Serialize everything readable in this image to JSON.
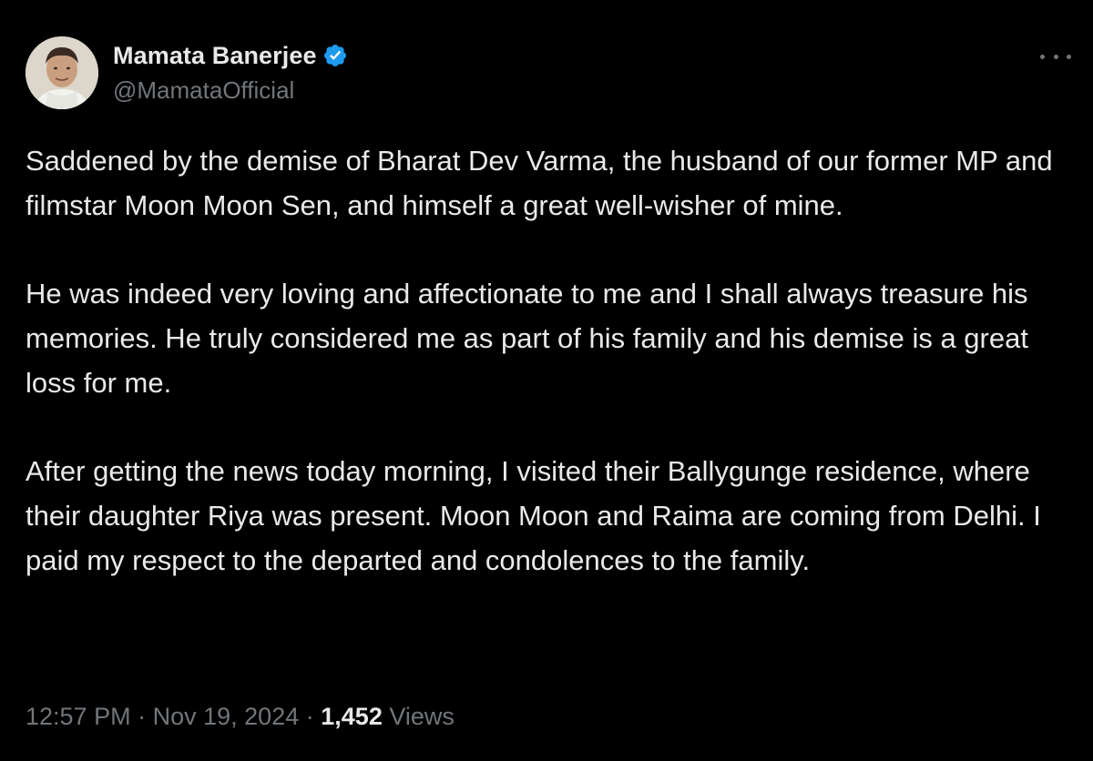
{
  "author": {
    "display_name": "Mamata Banerjee",
    "handle": "@MamataOfficial",
    "verified": true,
    "avatar_icon": "profile-photo",
    "verified_icon": "verified-badge-icon"
  },
  "menu": {
    "icon": "more-options-icon"
  },
  "tweet": {
    "paragraphs": [
      "Saddened by the demise of Bharat Dev Varma, the husband of our former MP and filmstar Moon Moon Sen, and himself a great well-wisher of mine.",
      "He was indeed very loving and affectionate to me and I shall always treasure his memories. He truly considered me as part of his family and his demise is a great loss for me.",
      "After getting the news today morning, I visited their Ballygunge residence, where their daughter Riya was present. Moon Moon and Raima are coming from Delhi. I paid my respect to the departed and condolences to the family."
    ]
  },
  "meta": {
    "time": "12:57 PM",
    "separator": "·",
    "date": "Nov 19, 2024",
    "views_count": "1,452",
    "views_label": "Views"
  },
  "colors": {
    "background": "#000000",
    "text_primary": "#e7e9ea",
    "text_secondary": "#71767b",
    "verified_blue": "#1d9bf0"
  }
}
